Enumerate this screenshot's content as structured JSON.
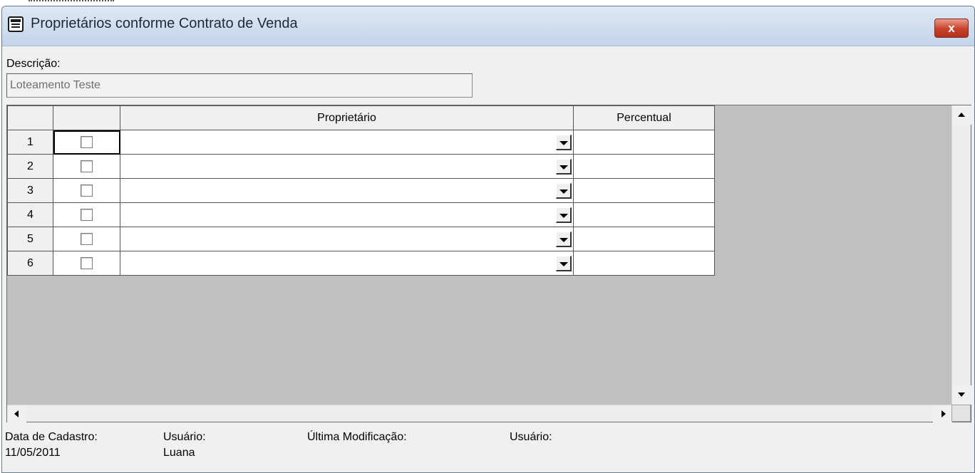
{
  "window": {
    "title": "Proprietários conforme Contrato de Venda",
    "close_label": "x"
  },
  "form": {
    "description_label": "Descrição:",
    "description_value": "Loteamento Teste"
  },
  "grid": {
    "headers": [
      "",
      "",
      "Proprietário",
      "Percentual"
    ],
    "rows": [
      {
        "num": "1",
        "checked": false,
        "proprietario": "",
        "percentual": ""
      },
      {
        "num": "2",
        "checked": false,
        "proprietario": "",
        "percentual": ""
      },
      {
        "num": "3",
        "checked": false,
        "proprietario": "",
        "percentual": ""
      },
      {
        "num": "4",
        "checked": false,
        "proprietario": "",
        "percentual": ""
      },
      {
        "num": "5",
        "checked": false,
        "proprietario": "",
        "percentual": ""
      },
      {
        "num": "6",
        "checked": false,
        "proprietario": "",
        "percentual": ""
      }
    ],
    "selected_row": 0
  },
  "footer": {
    "data_cadastro_label": "Data de Cadastro:",
    "data_cadastro_value": "11/05/2011",
    "usuario_label": "Usuário:",
    "usuario_value": "Luana",
    "ultima_mod_label": "Última Modificação:",
    "ultima_mod_value": "",
    "usuario2_label": "Usuário:",
    "usuario2_value": ""
  }
}
